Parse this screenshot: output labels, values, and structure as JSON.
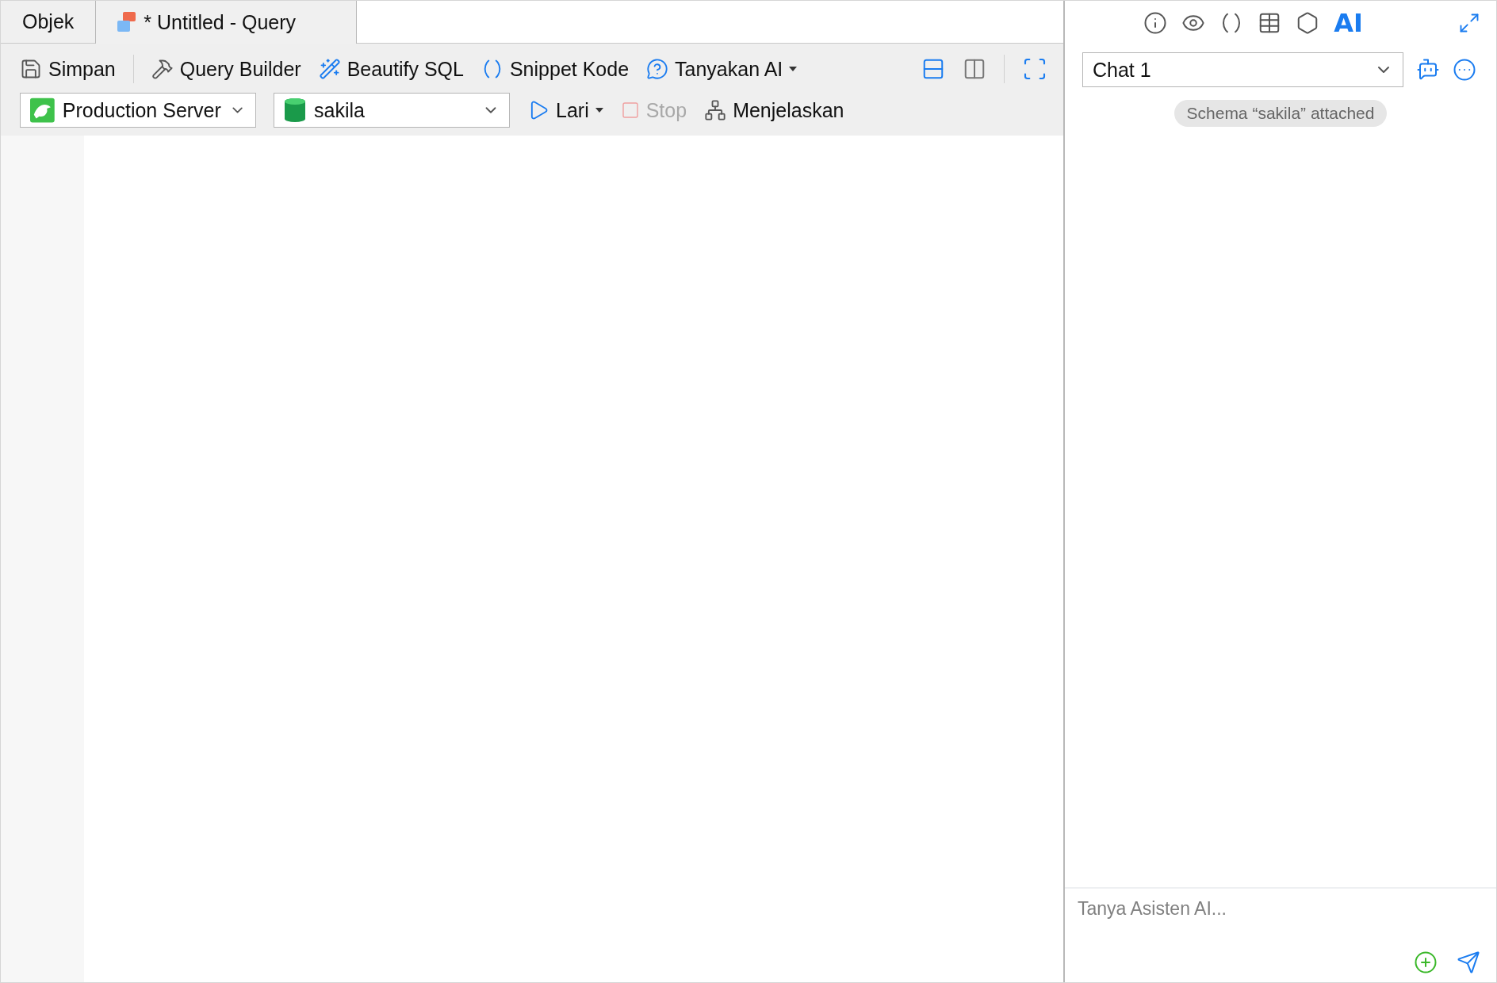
{
  "tabs": [
    {
      "label": "Objek",
      "selected": false
    },
    {
      "label": "* Untitled - Query",
      "selected": true
    }
  ],
  "toolbar": {
    "items": [
      {
        "kind": "save",
        "label": "Simpan",
        "has_menu": false
      },
      {
        "kind": "builder",
        "label": "Query Builder",
        "has_menu": false
      },
      {
        "kind": "beautify",
        "label": "Beautify SQL",
        "has_menu": false
      },
      {
        "kind": "snippet",
        "label": "Snippet Kode",
        "has_menu": false
      },
      {
        "kind": "ask_ai",
        "label": "Tanyakan AI",
        "has_menu": true
      }
    ],
    "connection": {
      "value": "Production Server"
    },
    "database": {
      "value": "sakila"
    },
    "actions": [
      {
        "kind": "run",
        "label": "Lari",
        "has_menu": true,
        "disabled": false
      },
      {
        "kind": "stop",
        "label": "Stop",
        "has_menu": false,
        "disabled": true
      },
      {
        "kind": "explain",
        "label": "Menjelaskan",
        "has_menu": false,
        "disabled": false
      }
    ]
  },
  "panel_tabs": [
    {
      "kind": "info",
      "selected": false
    },
    {
      "kind": "preview",
      "selected": false
    },
    {
      "kind": "snippets",
      "selected": false
    },
    {
      "kind": "table",
      "selected": false
    },
    {
      "kind": "model",
      "selected": false
    },
    {
      "kind": "ai",
      "label": "AI",
      "selected": true
    }
  ],
  "chat": {
    "selector": {
      "value": "Chat 1"
    },
    "notice": "Schema “sakila” attached",
    "input": {
      "placeholder": "Tanya Asisten AI..."
    }
  }
}
